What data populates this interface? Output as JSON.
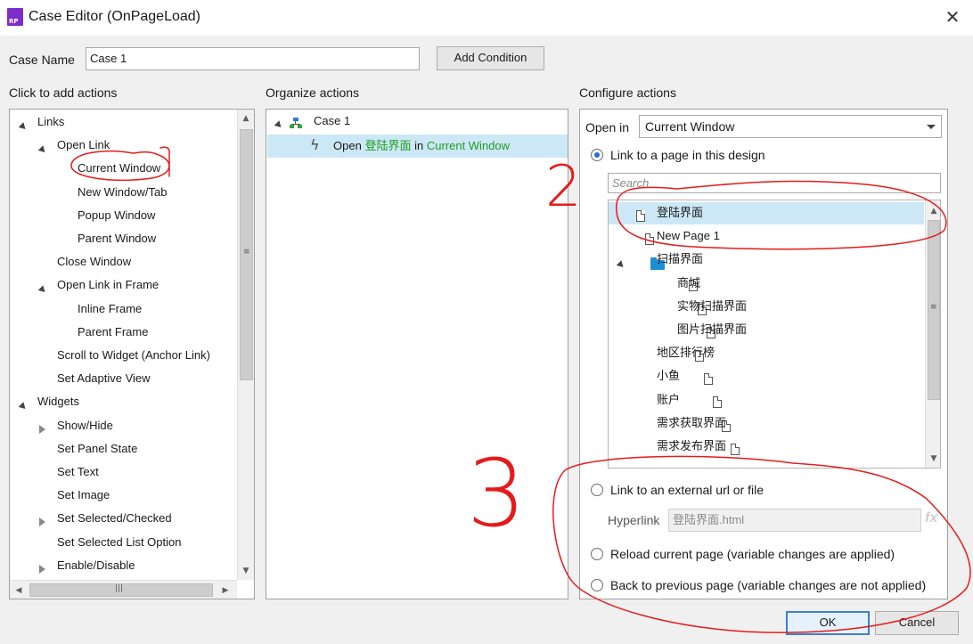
{
  "window": {
    "title": "Case Editor (OnPageLoad)",
    "app_icon_text": "RP",
    "close_glyph": "✕"
  },
  "case_name": {
    "label": "Case Name",
    "value": "Case 1"
  },
  "add_condition_label": "Add Condition",
  "panels": {
    "add_actions_title": "Click to add actions",
    "organize_title": "Organize actions",
    "configure_title": "Configure actions"
  },
  "actions_tree": [
    {
      "label": "Links",
      "level": 0,
      "expander": "open"
    },
    {
      "label": "Open Link",
      "level": 1,
      "expander": "open"
    },
    {
      "label": "Current Window",
      "level": 2,
      "expander": "none"
    },
    {
      "label": "New Window/Tab",
      "level": 2,
      "expander": "none"
    },
    {
      "label": "Popup Window",
      "level": 2,
      "expander": "none"
    },
    {
      "label": "Parent Window",
      "level": 2,
      "expander": "none"
    },
    {
      "label": "Close Window",
      "level": 1,
      "expander": "none"
    },
    {
      "label": "Open Link in Frame",
      "level": 1,
      "expander": "open"
    },
    {
      "label": "Inline Frame",
      "level": 2,
      "expander": "none"
    },
    {
      "label": "Parent Frame",
      "level": 2,
      "expander": "none"
    },
    {
      "label": "Scroll to Widget (Anchor Link)",
      "level": 1,
      "expander": "none"
    },
    {
      "label": "Set Adaptive View",
      "level": 1,
      "expander": "none"
    },
    {
      "label": "Widgets",
      "level": 0,
      "expander": "open"
    },
    {
      "label": "Show/Hide",
      "level": 1,
      "expander": "closed"
    },
    {
      "label": "Set Panel State",
      "level": 1,
      "expander": "none"
    },
    {
      "label": "Set Text",
      "level": 1,
      "expander": "none"
    },
    {
      "label": "Set Image",
      "level": 1,
      "expander": "none"
    },
    {
      "label": "Set Selected/Checked",
      "level": 1,
      "expander": "closed"
    },
    {
      "label": "Set Selected List Option",
      "level": 1,
      "expander": "none"
    },
    {
      "label": "Enable/Disable",
      "level": 1,
      "expander": "closed"
    }
  ],
  "organize": {
    "case_label": "Case 1",
    "action": {
      "verb": "Open",
      "page": "登陆界面",
      "in": "in",
      "target": "Current Window"
    }
  },
  "configure": {
    "open_in_label": "Open in",
    "open_in_value": "Current Window",
    "link_page_label": "Link to a page in this design",
    "search_placeholder": "Search",
    "pages": [
      {
        "label": "登陆界面",
        "level": 0,
        "kind": "page",
        "selected": true
      },
      {
        "label": "New Page 1",
        "level": 0,
        "kind": "page",
        "selected": false
      },
      {
        "label": "扫描界面",
        "level": 0,
        "kind": "folder",
        "selected": false
      },
      {
        "label": "商城",
        "level": 1,
        "kind": "page",
        "selected": false
      },
      {
        "label": "实物扫描界面",
        "level": 1,
        "kind": "page",
        "selected": false
      },
      {
        "label": "图片扫描界面",
        "level": 1,
        "kind": "page",
        "selected": false
      },
      {
        "label": "地区排行榜",
        "level": 0,
        "kind": "page",
        "selected": false
      },
      {
        "label": "小鱼",
        "level": 0,
        "kind": "page",
        "selected": false
      },
      {
        "label": "账户",
        "level": 0,
        "kind": "page",
        "selected": false
      },
      {
        "label": "需求获取界面",
        "level": 0,
        "kind": "page",
        "selected": false
      },
      {
        "label": "需求发布界面",
        "level": 0,
        "kind": "page",
        "selected": false
      }
    ],
    "external_label": "Link to an external url or file",
    "hyperlink_label": "Hyperlink",
    "hyperlink_value": "登陆界面.html",
    "fx_label": "fx",
    "reload_label": "Reload current page (variable changes are applied)",
    "back_label": "Back to previous page (variable changes are not applied)"
  },
  "ok_label": "OK",
  "cancel_label": "Cancel",
  "annotations": [
    "2",
    "3"
  ],
  "colors": {
    "selection": "#cce8f6",
    "green_text": "#1f9c1f",
    "annotation_red": "#e51b1b",
    "folder_blue": "#1b8fd6",
    "ok_border": "#3c7fd0"
  }
}
